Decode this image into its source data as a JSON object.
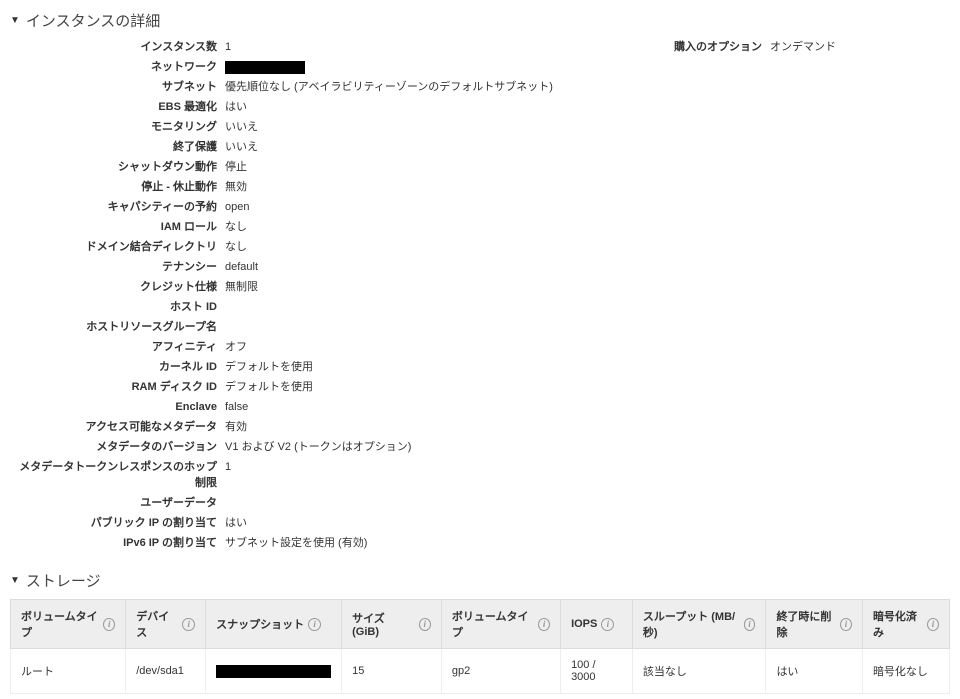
{
  "sections": {
    "instance_details": {
      "title": "インスタンスの詳細",
      "purchase_option_label": "購入のオプション",
      "purchase_option_value": "オンデマンド",
      "rows": [
        {
          "label": "インスタンス数",
          "value": "1"
        },
        {
          "label": "ネットワーク",
          "value": "",
          "redacted": true
        },
        {
          "label": "サブネット",
          "value": "優先順位なし (アベイラビリティーゾーンのデフォルトサブネット)"
        },
        {
          "label": "EBS 最適化",
          "value": "はい"
        },
        {
          "label": "モニタリング",
          "value": "いいえ"
        },
        {
          "label": "終了保護",
          "value": "いいえ"
        },
        {
          "label": "シャットダウン動作",
          "value": "停止"
        },
        {
          "label": "停止 - 休止動作",
          "value": "無効"
        },
        {
          "label": "キャパシティーの予約",
          "value": "open"
        },
        {
          "label": "IAM ロール",
          "value": "なし"
        },
        {
          "label": "ドメイン結合ディレクトリ",
          "value": "なし"
        },
        {
          "label": "テナンシー",
          "value": "default"
        },
        {
          "label": "クレジット仕様",
          "value": "無制限"
        },
        {
          "label": "ホスト ID",
          "value": ""
        },
        {
          "label": "ホストリソースグループ名",
          "value": ""
        },
        {
          "label": "アフィニティ",
          "value": "オフ"
        },
        {
          "label": "カーネル ID",
          "value": "デフォルトを使用"
        },
        {
          "label": "RAM ディスク ID",
          "value": "デフォルトを使用"
        },
        {
          "label": "Enclave",
          "value": "false"
        },
        {
          "label": "アクセス可能なメタデータ",
          "value": "有効"
        },
        {
          "label": "メタデータのバージョン",
          "value": "V1 および V2 (トークンはオプション)"
        },
        {
          "label": "メタデータトークンレスポンスのホップ制限",
          "value": "1"
        },
        {
          "label": "ユーザーデータ",
          "value": ""
        },
        {
          "label": "パブリック IP の割り当て",
          "value": "はい"
        },
        {
          "label": "IPv6 IP の割り当て",
          "value": "サブネット設定を使用 (有効)"
        }
      ]
    },
    "storage": {
      "title": "ストレージ",
      "headers": {
        "volume_type_cat": "ボリュームタイプ",
        "device": "デバイス",
        "snapshot": "スナップショット",
        "size": "サイズ (GiB)",
        "volume_type": "ボリュームタイプ",
        "iops": "IOPS",
        "throughput": "スループット (MB/秒)",
        "delete_on_term": "終了時に削除",
        "encrypted": "暗号化済み"
      },
      "rows": [
        {
          "volume_type_cat": "ルート",
          "device": "/dev/sda1",
          "snapshot": "",
          "snapshot_redacted": true,
          "size": "15",
          "volume_type": "gp2",
          "iops": "100 / 3000",
          "throughput": "該当なし",
          "delete_on_term": "はい",
          "encrypted": "暗号化なし"
        }
      ]
    }
  }
}
